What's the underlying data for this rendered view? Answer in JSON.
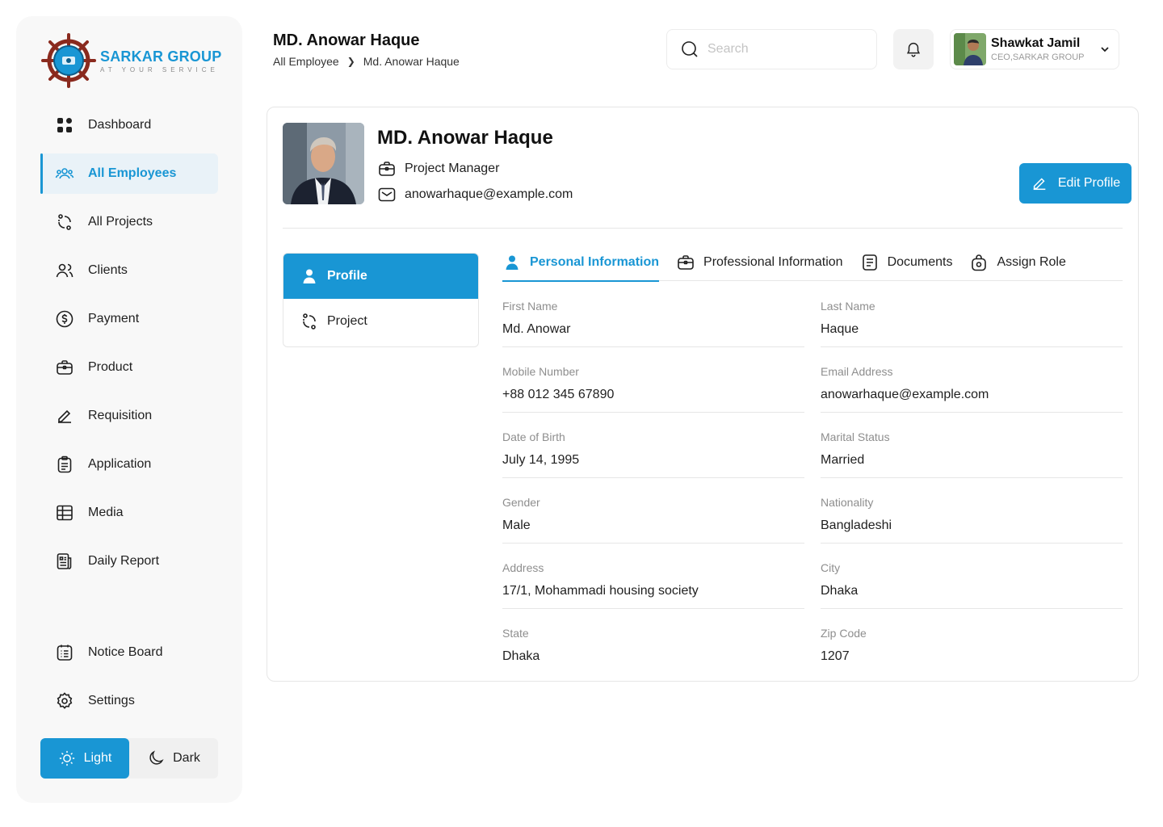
{
  "brand": {
    "name": "SARKAR GROUP",
    "tagline": "AT YOUR SERVICE"
  },
  "sidebar": {
    "items": [
      {
        "label": "Dashboard",
        "icon": "grid-icon"
      },
      {
        "label": "All Employees",
        "icon": "users-icon",
        "active": true
      },
      {
        "label": "All Projects",
        "icon": "projects-icon"
      },
      {
        "label": "Clients",
        "icon": "clients-icon"
      },
      {
        "label": "Payment",
        "icon": "dollar-icon"
      },
      {
        "label": "Product",
        "icon": "briefcase-icon"
      },
      {
        "label": "Requisition",
        "icon": "pen-icon"
      },
      {
        "label": "Application",
        "icon": "clipboard-icon"
      },
      {
        "label": "Media",
        "icon": "table-icon"
      },
      {
        "label": "Daily Report",
        "icon": "report-icon"
      }
    ],
    "bottom_items": [
      {
        "label": "Notice Board",
        "icon": "list-icon"
      },
      {
        "label": "Settings",
        "icon": "gear-icon"
      }
    ],
    "theme": {
      "light": "Light",
      "dark": "Dark",
      "selected": "Light"
    }
  },
  "header": {
    "title": "MD. Anowar Haque",
    "breadcrumb": [
      "All Employee",
      "Md. Anowar Haque"
    ],
    "search_placeholder": "Search",
    "user": {
      "name": "Shawkat Jamil",
      "role": "CEO,SARKAR GROUP"
    }
  },
  "profile": {
    "name": "MD. Anowar Haque",
    "designation": "Project Manager",
    "email": "anowarhaque@example.com",
    "edit_label": "Edit Profile"
  },
  "side_tabs": [
    {
      "label": "Profile",
      "active": true
    },
    {
      "label": "Project",
      "active": false
    }
  ],
  "tabs": [
    {
      "label": "Personal Information",
      "active": true
    },
    {
      "label": "Professional Information"
    },
    {
      "label": "Documents"
    },
    {
      "label": "Assign Role"
    }
  ],
  "fields": [
    [
      {
        "label": "First Name",
        "value": "Md. Anowar"
      },
      {
        "label": "Last Name",
        "value": "Haque"
      }
    ],
    [
      {
        "label": "Mobile Number",
        "value": "+88 012 345 67890"
      },
      {
        "label": "Email Address",
        "value": "anowarhaque@example.com"
      }
    ],
    [
      {
        "label": "Date of Birth",
        "value": "July 14, 1995"
      },
      {
        "label": "Marital Status",
        "value": "Married"
      }
    ],
    [
      {
        "label": "Gender",
        "value": "Male"
      },
      {
        "label": "Nationality",
        "value": "Bangladeshi"
      }
    ],
    [
      {
        "label": "Address",
        "value": "17/1, Mohammadi housing society"
      },
      {
        "label": "City",
        "value": "Dhaka"
      }
    ],
    [
      {
        "label": "State",
        "value": "Dhaka"
      },
      {
        "label": "Zip Code",
        "value": "1207"
      }
    ]
  ],
  "colors": {
    "accent": "#1996d4",
    "active_bg": "#e9f2f8",
    "border": "#e6e6e6"
  }
}
